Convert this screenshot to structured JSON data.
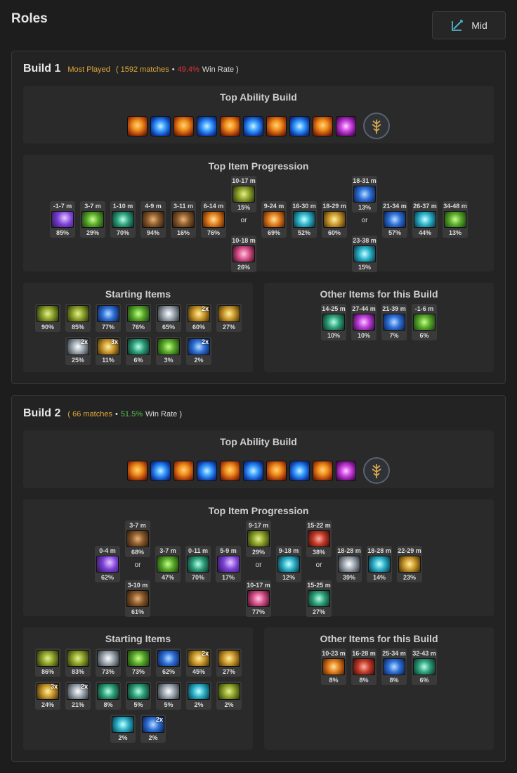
{
  "page": {
    "title": "Roles",
    "role_button": "Mid"
  },
  "builds": [
    {
      "name": "Build 1",
      "label": "Most Played",
      "matches": "1592 matches",
      "sep": "•",
      "winrate": "49.4%",
      "winrate_label": "Win Rate",
      "ability_title": "Top Ability Build",
      "abilities": [
        "fire",
        "blue",
        "fire",
        "blue",
        "fire",
        "blue",
        "fire",
        "blue",
        "fire",
        "purple"
      ],
      "progression_title": "Top Item Progression",
      "progression": [
        {
          "time": "-1-7 m",
          "pct": "85%",
          "icon": "purple"
        },
        {
          "time": "3-7 m",
          "pct": "29%",
          "icon": "green"
        },
        {
          "time": "1-10 m",
          "pct": "70%",
          "icon": "teal"
        },
        {
          "time": "4-9 m",
          "pct": "94%",
          "icon": "brown"
        },
        {
          "time": "3-11 m",
          "pct": "16%",
          "icon": "brown"
        },
        {
          "time": "6-14 m",
          "pct": "76%",
          "icon": "orange"
        },
        {
          "time": "10-17 m",
          "pct": "15%",
          "icon": "olive",
          "alt": {
            "time": "10-18 m",
            "pct": "26%",
            "icon": "pink"
          }
        },
        {
          "time": "9-24 m",
          "pct": "69%",
          "icon": "orange"
        },
        {
          "time": "16-30 m",
          "pct": "52%",
          "icon": "cyan"
        },
        {
          "time": "18-29 m",
          "pct": "60%",
          "icon": "gold"
        },
        {
          "time": "18-31 m",
          "pct": "13%",
          "icon": "blue",
          "alt": {
            "time": "23-38 m",
            "pct": "15%",
            "icon": "cyan"
          }
        },
        {
          "time": "21-34 m",
          "pct": "57%",
          "icon": "blue"
        },
        {
          "time": "26-37 m",
          "pct": "44%",
          "icon": "cyan"
        },
        {
          "time": "34-48 m",
          "pct": "13%",
          "icon": "green"
        }
      ],
      "or_label": "or",
      "starting_title": "Starting Items",
      "starting": [
        {
          "pct": "90%",
          "icon": "olive"
        },
        {
          "pct": "85%",
          "icon": "olive"
        },
        {
          "pct": "77%",
          "icon": "blue"
        },
        {
          "pct": "76%",
          "icon": "green"
        },
        {
          "pct": "65%",
          "icon": "silver"
        },
        {
          "pct": "60%",
          "icon": "gold",
          "mult": "2x"
        },
        {
          "pct": "27%",
          "icon": "gold"
        },
        {
          "pct": "25%",
          "icon": "silver",
          "mult": "2x"
        },
        {
          "pct": "11%",
          "icon": "gold",
          "mult": "3x"
        },
        {
          "pct": "6%",
          "icon": "teal"
        },
        {
          "pct": "3%",
          "icon": "green"
        },
        {
          "pct": "2%",
          "icon": "blue",
          "mult": "2x"
        }
      ],
      "other_title": "Other Items for this Build",
      "other": [
        {
          "time": "14-25 m",
          "pct": "10%",
          "icon": "teal"
        },
        {
          "time": "27-44 m",
          "pct": "10%",
          "icon": "magenta"
        },
        {
          "time": "21-39 m",
          "pct": "7%",
          "icon": "blue"
        },
        {
          "time": "-1-6 m",
          "pct": "6%",
          "icon": "green"
        }
      ]
    },
    {
      "name": "Build 2",
      "label": "",
      "matches": "66 matches",
      "sep": "•",
      "winrate": "51.5%",
      "winrate_label": "Win Rate",
      "ability_title": "Top Ability Build",
      "abilities": [
        "fire",
        "blue",
        "fire",
        "blue",
        "fire",
        "blue",
        "fire",
        "blue",
        "fire",
        "purple"
      ],
      "progression_title": "Top Item Progression",
      "progression": [
        {
          "time": "0-4 m",
          "pct": "62%",
          "icon": "purple"
        },
        {
          "time": "3-7 m",
          "pct": "68%",
          "icon": "brown",
          "alt": {
            "time": "3-10 m",
            "pct": "61%",
            "icon": "brown"
          }
        },
        {
          "time": "3-7 m",
          "pct": "47%",
          "icon": "green"
        },
        {
          "time": "0-11 m",
          "pct": "70%",
          "icon": "teal"
        },
        {
          "time": "5-9 m",
          "pct": "17%",
          "icon": "purple"
        },
        {
          "time": "9-17 m",
          "pct": "29%",
          "icon": "olive",
          "alt": {
            "time": "10-17 m",
            "pct": "77%",
            "icon": "pink"
          }
        },
        {
          "time": "9-18 m",
          "pct": "12%",
          "icon": "cyan"
        },
        {
          "time": "15-22 m",
          "pct": "38%",
          "icon": "red",
          "alt": {
            "time": "15-25 m",
            "pct": "27%",
            "icon": "teal"
          }
        },
        {
          "time": "18-28 m",
          "pct": "39%",
          "icon": "silver"
        },
        {
          "time": "18-28 m",
          "pct": "14%",
          "icon": "cyan"
        },
        {
          "time": "22-29 m",
          "pct": "23%",
          "icon": "gold"
        }
      ],
      "or_label": "or",
      "starting_title": "Starting Items",
      "starting": [
        {
          "pct": "86%",
          "icon": "olive"
        },
        {
          "pct": "83%",
          "icon": "olive"
        },
        {
          "pct": "73%",
          "icon": "silver"
        },
        {
          "pct": "73%",
          "icon": "green"
        },
        {
          "pct": "62%",
          "icon": "blue"
        },
        {
          "pct": "45%",
          "icon": "gold",
          "mult": "2x"
        },
        {
          "pct": "27%",
          "icon": "gold"
        },
        {
          "pct": "24%",
          "icon": "gold",
          "mult": "3x"
        },
        {
          "pct": "21%",
          "icon": "silver",
          "mult": "2x"
        },
        {
          "pct": "8%",
          "icon": "teal"
        },
        {
          "pct": "5%",
          "icon": "teal"
        },
        {
          "pct": "5%",
          "icon": "silver"
        },
        {
          "pct": "2%",
          "icon": "cyan"
        },
        {
          "pct": "2%",
          "icon": "olive"
        },
        {
          "pct": "2%",
          "icon": "cyan"
        },
        {
          "pct": "2%",
          "icon": "blue",
          "mult": "2x"
        }
      ],
      "other_title": "Other Items for this Build",
      "other": [
        {
          "time": "10-23 m",
          "pct": "8%",
          "icon": "orange"
        },
        {
          "time": "16-28 m",
          "pct": "8%",
          "icon": "red"
        },
        {
          "time": "25-34 m",
          "pct": "8%",
          "icon": "blue"
        },
        {
          "time": "32-43 m",
          "pct": "6%",
          "icon": "teal"
        }
      ]
    }
  ]
}
